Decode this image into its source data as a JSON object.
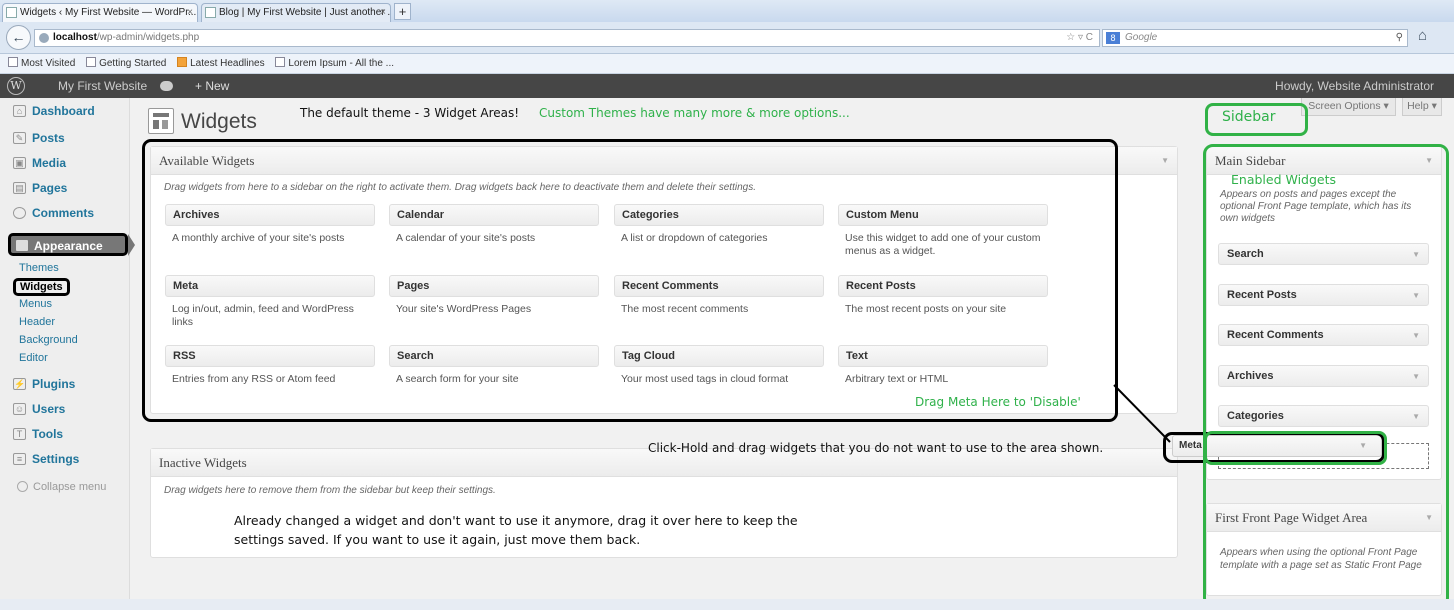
{
  "browser": {
    "tabs": [
      {
        "label": "Widgets ‹ My First Website — WordPr...",
        "close": "×"
      },
      {
        "label": "Blog | My First Website | Just another ...",
        "close": "×"
      }
    ],
    "new_tab": "+",
    "url_host": "localhost",
    "url_path": "/wp-admin/widgets.php",
    "url_icons": "☆ ▿ C",
    "search_placeholder": "Google",
    "search_engine": "8",
    "bookmarks": [
      "Most Visited",
      "Getting Started",
      "Latest Headlines",
      "Lorem Ipsum - All the ..."
    ]
  },
  "adminbar": {
    "logo": "W",
    "site_name": "My First Website",
    "new_label": "+ New",
    "howdy": "Howdy, Website Administrator"
  },
  "menu": {
    "dashboard": "Dashboard",
    "posts": "Posts",
    "media": "Media",
    "pages": "Pages",
    "comments": "Comments",
    "appearance": "Appearance",
    "sub": [
      "Themes",
      "Widgets",
      "Menus",
      "Header",
      "Background",
      "Editor"
    ],
    "plugins": "Plugins",
    "users": "Users",
    "tools": "Tools",
    "settings": "Settings",
    "collapse": "Collapse menu"
  },
  "page": {
    "title": "Widgets",
    "screen_options": "Screen Options ▾",
    "help": "Help ▾"
  },
  "available": {
    "title": "Available Widgets",
    "description": "Drag widgets from here to a sidebar on the right to activate them. Drag widgets back here to deactivate them and delete their settings.",
    "widgets": [
      {
        "name": "Archives",
        "desc": "A monthly archive of your site's posts"
      },
      {
        "name": "Calendar",
        "desc": "A calendar of your site's posts"
      },
      {
        "name": "Categories",
        "desc": "A list or dropdown of categories"
      },
      {
        "name": "Custom Menu",
        "desc": "Use this widget to add one of your custom menus as a widget."
      },
      {
        "name": "Meta",
        "desc": "Log in/out, admin, feed and WordPress links"
      },
      {
        "name": "Pages",
        "desc": "Your site's WordPress Pages"
      },
      {
        "name": "Recent Comments",
        "desc": "The most recent comments"
      },
      {
        "name": "Recent Posts",
        "desc": "The most recent posts on your site"
      },
      {
        "name": "RSS",
        "desc": "Entries from any RSS or Atom feed"
      },
      {
        "name": "Search",
        "desc": "A search form for your site"
      },
      {
        "name": "Tag Cloud",
        "desc": "Your most used tags in cloud format"
      },
      {
        "name": "Text",
        "desc": "Arbitrary text or HTML"
      }
    ]
  },
  "inactive": {
    "title": "Inactive Widgets",
    "description": "Drag widgets here to remove them from the sidebar but keep their settings."
  },
  "main_sidebar": {
    "title": "Main Sidebar",
    "description": "Appears on posts and pages except the optional Front Page template, which has its own widgets",
    "widgets": [
      "Search",
      "Recent Posts",
      "Recent Comments",
      "Archives",
      "Categories"
    ],
    "dragging": "Meta"
  },
  "front_page_area": {
    "title": "First Front Page Widget Area",
    "description": "Appears when using the optional Front Page template with a page set as Static Front Page"
  },
  "annotations": {
    "default_theme": "The default theme - 3 Widget Areas!",
    "custom_themes": "Custom Themes have many more & more options...",
    "sidebar": "Sidebar",
    "enabled_widgets": "Enabled Widgets",
    "drag_meta": "Drag Meta Here to 'Disable'",
    "click_hold": "Click-Hold and drag widgets that you do not want to use to the area shown.",
    "already_changed_1": "Already changed a widget and don't want to use it anymore, drag it over here to keep the",
    "already_changed_2": "settings saved. If you want to use it again, just move them back."
  },
  "colors": {
    "annotation_green": "#2fb14a",
    "link": "#21759b",
    "adminbar": "#464646"
  }
}
